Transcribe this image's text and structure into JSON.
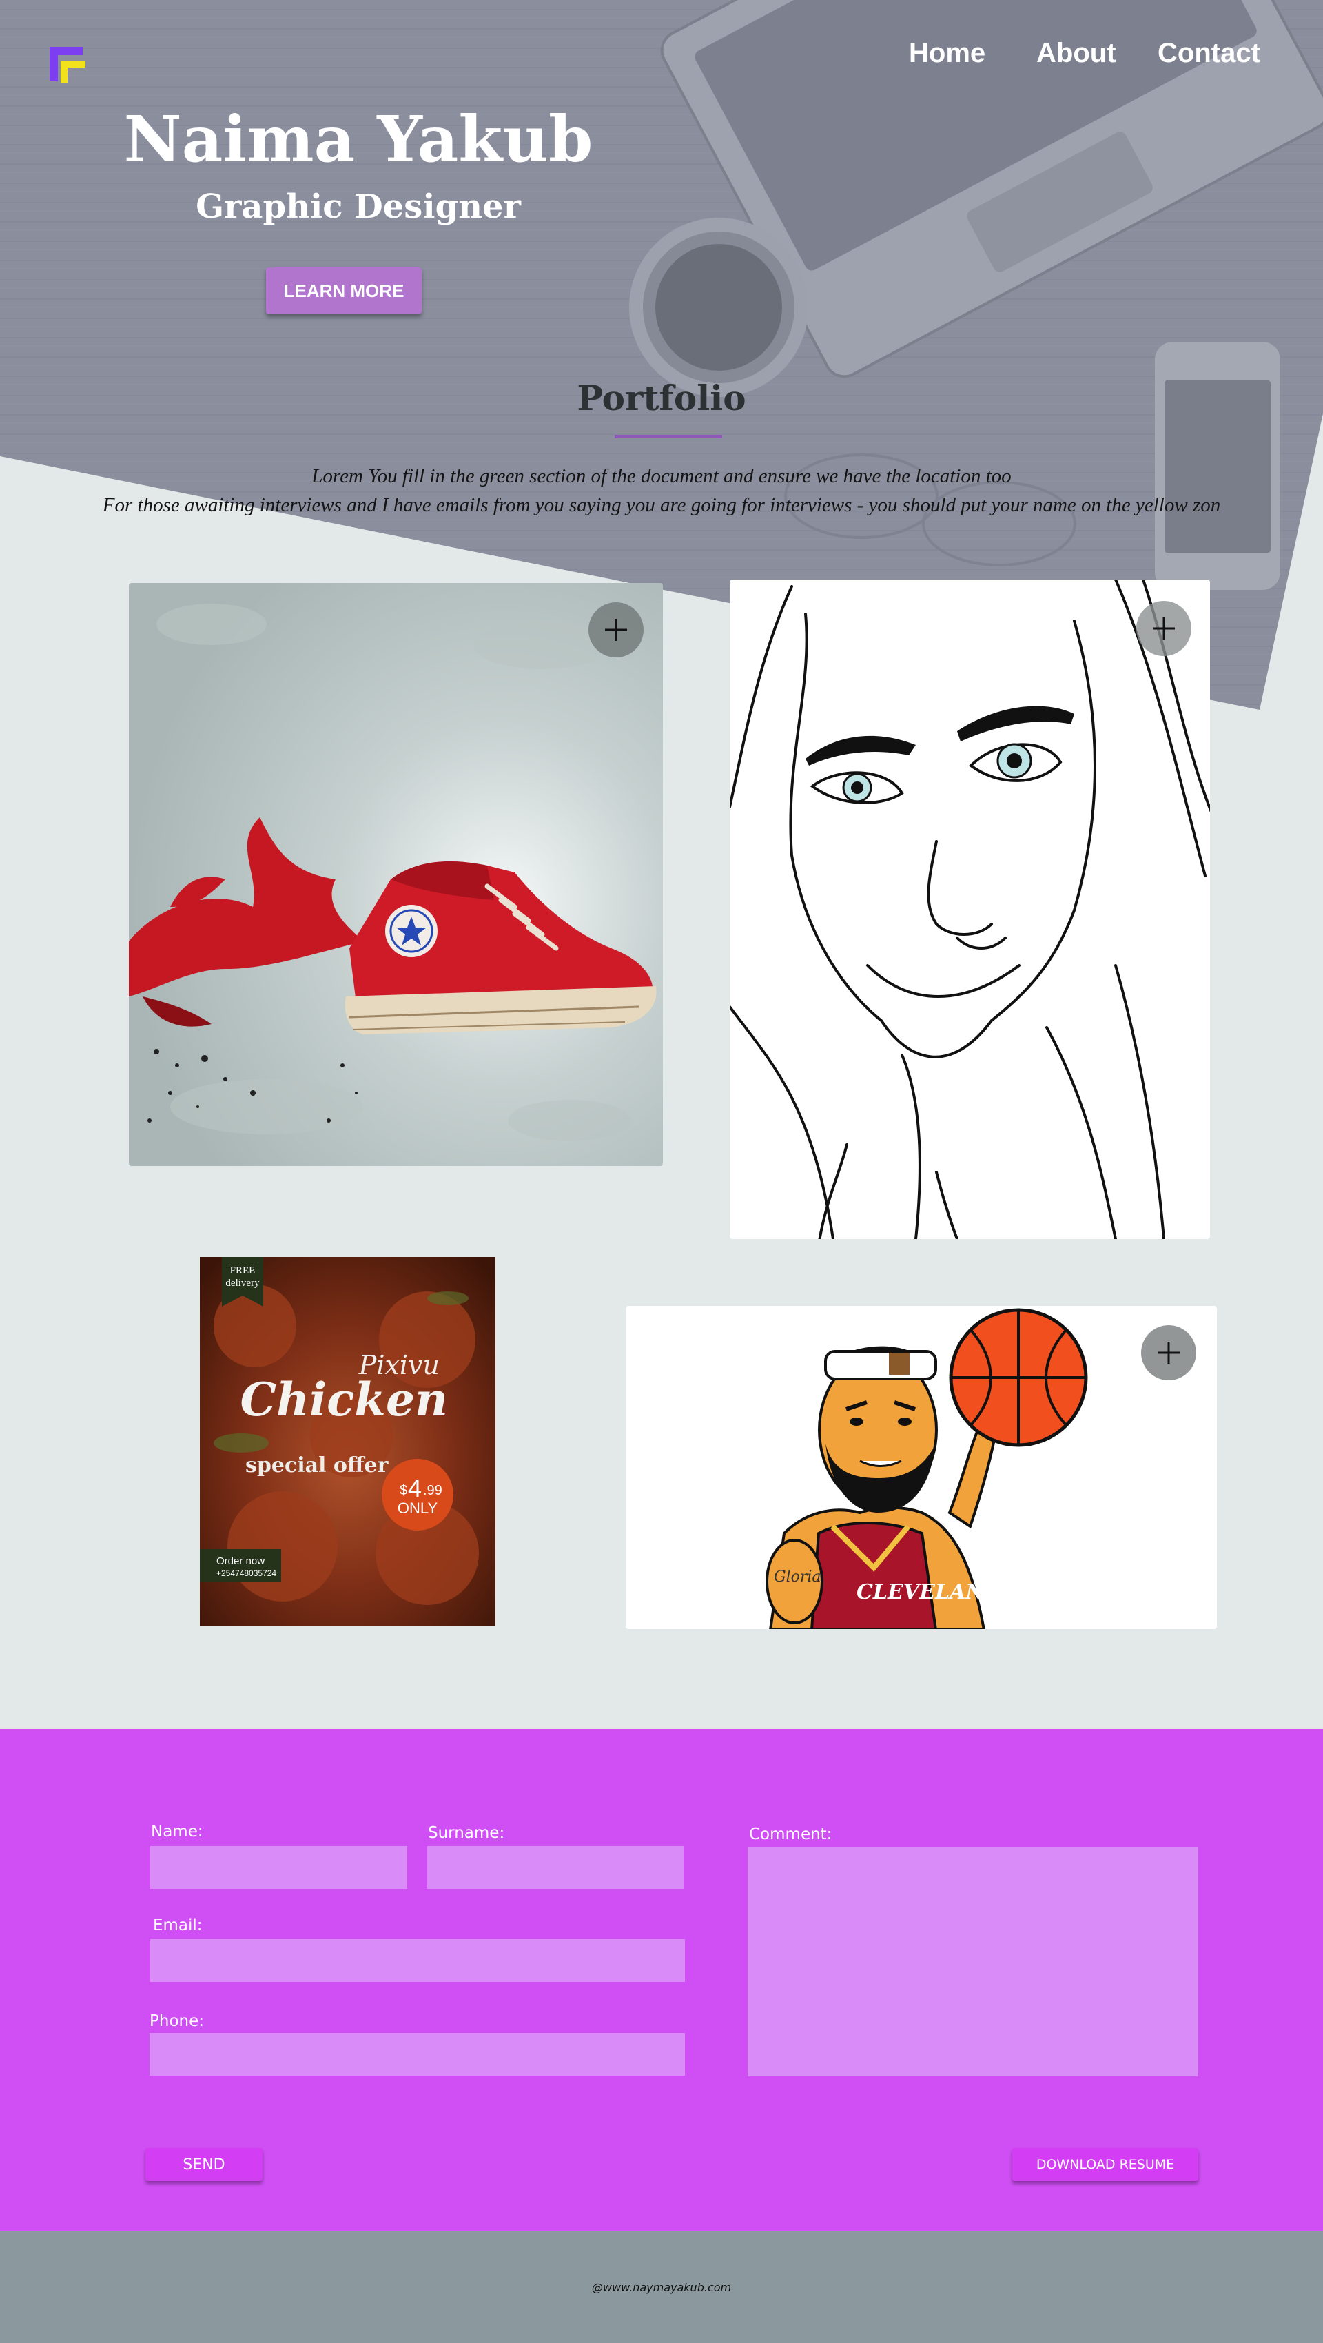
{
  "colors": {
    "hero_overlay": "#8b8f9f",
    "accent": "#cf4ff4",
    "button_purple": "#b275cd",
    "footer": "#8b999f",
    "page_bg": "#e3e8e8"
  },
  "logo": {
    "icon": "brand-logo-icon"
  },
  "nav": {
    "items": [
      "Home",
      "About",
      "Contact"
    ]
  },
  "hero": {
    "name": "Naima Yakub",
    "role": "Graphic Designer",
    "cta_label": "LEARN MORE"
  },
  "portfolio": {
    "title": "Portfolio",
    "description_line1": "Lorem You fill in the green section of the document and ensure we have the location too",
    "description_line2": "For those awaiting interviews and I have emails from you saying you are going for interviews - you should put your name on the yellow zon",
    "expand_icon": "plus-icon",
    "items": [
      {
        "subject": "red high-top sneaker with paint splash"
      },
      {
        "subject": "line-art portrait of woman in hoodie"
      },
      {
        "subject": "chicken promotional poster",
        "badge_line1": "FREE",
        "badge_line2": "delivery",
        "brand": "Pixivu",
        "headline": "Chicken",
        "offer": "special offer",
        "currency": "$",
        "price_main": "4",
        "price_cents": ".99",
        "price_suffix": "ONLY",
        "order_line1": "Order now",
        "order_line2": "+254748035724"
      },
      {
        "subject": "cartoon basketball player spinning ball",
        "jersey_text": "CLEVELAND",
        "tattoo_text": "Gloria"
      }
    ]
  },
  "contact": {
    "name_label": "Name:",
    "surname_label": "Surname:",
    "email_label": "Email:",
    "phone_label": "Phone:",
    "comment_label": "Comment:",
    "name_value": "",
    "surname_value": "",
    "email_value": "",
    "phone_value": "",
    "comment_value": "",
    "send_label": "SEND",
    "resume_label": "DOWNLOAD  RESUME"
  },
  "footer": {
    "text": "@www.naymayakub.com"
  }
}
